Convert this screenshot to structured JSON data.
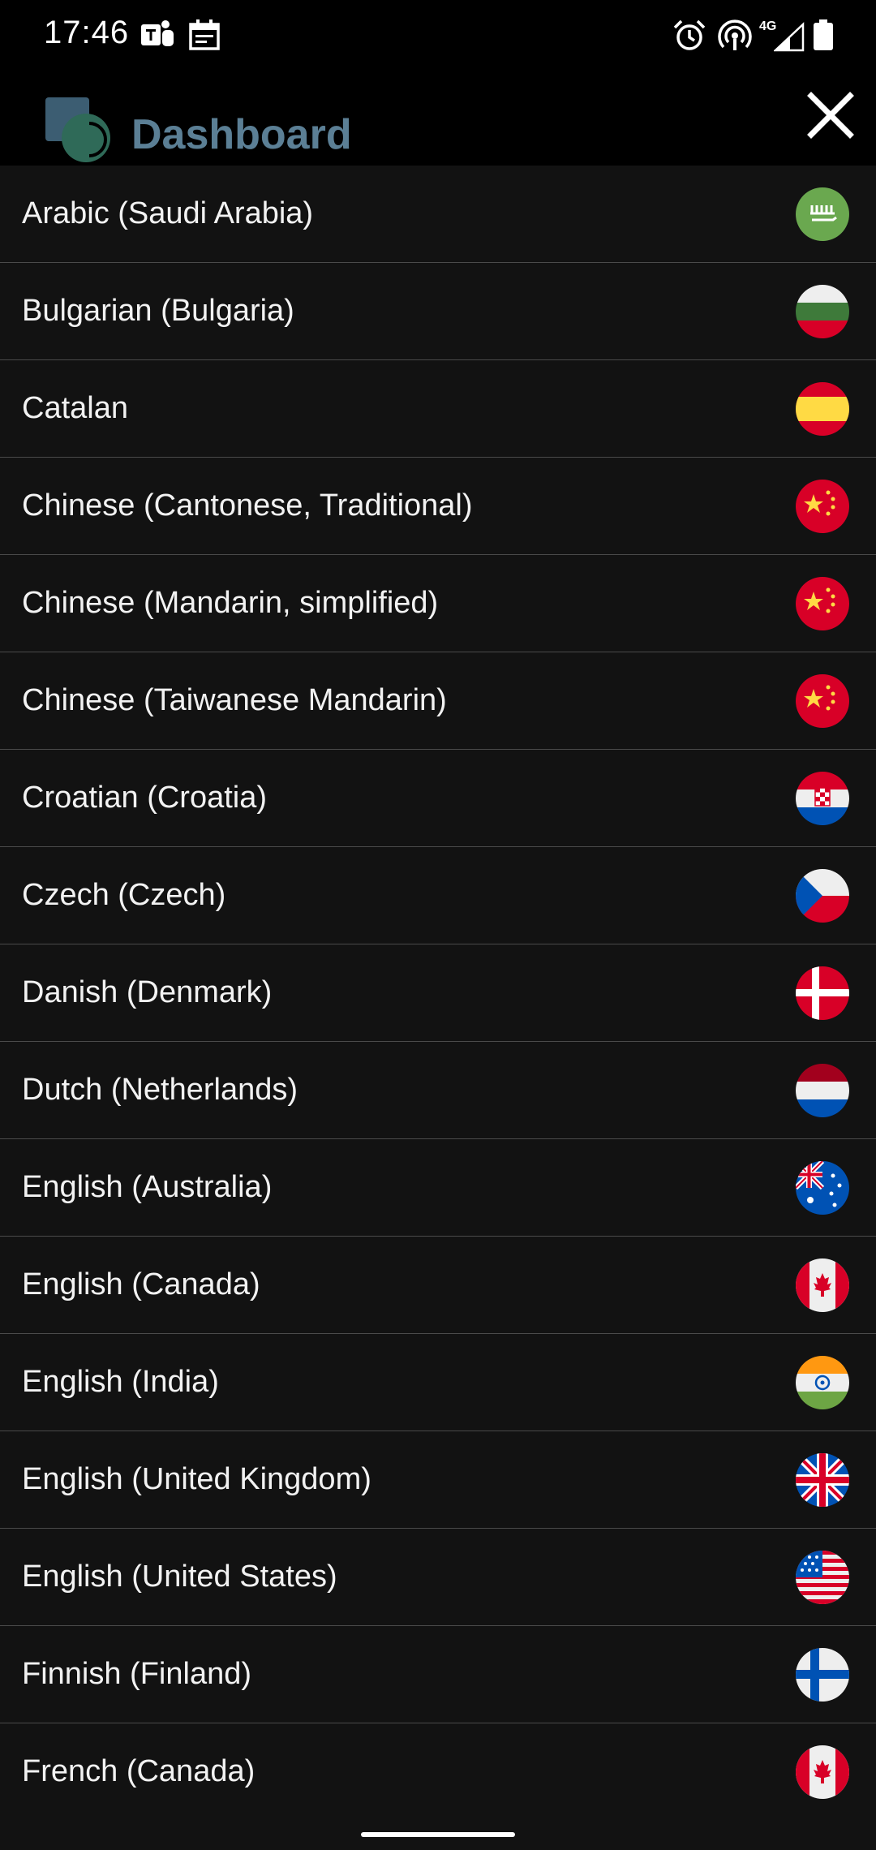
{
  "status_bar": {
    "time": "17:46",
    "network": "4G"
  },
  "header": {
    "title": "Dashboard",
    "accent": "#5b7f95"
  },
  "languages": [
    {
      "label": "Arabic (Saudi Arabia)",
      "flag": "flag-saudi-arabia-icon"
    },
    {
      "label": "Bulgarian (Bulgaria)",
      "flag": "flag-bulgaria-icon"
    },
    {
      "label": "Catalan",
      "flag": "flag-spain-icon"
    },
    {
      "label": "Chinese (Cantonese, Traditional)",
      "flag": "flag-china-icon"
    },
    {
      "label": "Chinese (Mandarin, simplified)",
      "flag": "flag-china-icon"
    },
    {
      "label": "Chinese (Taiwanese Mandarin)",
      "flag": "flag-china-icon"
    },
    {
      "label": "Croatian (Croatia)",
      "flag": "flag-croatia-icon"
    },
    {
      "label": "Czech (Czech)",
      "flag": "flag-czech-icon"
    },
    {
      "label": "Danish (Denmark)",
      "flag": "flag-denmark-icon"
    },
    {
      "label": "Dutch (Netherlands)",
      "flag": "flag-netherlands-icon"
    },
    {
      "label": "English (Australia)",
      "flag": "flag-australia-icon"
    },
    {
      "label": "English (Canada)",
      "flag": "flag-canada-icon"
    },
    {
      "label": "English (India)",
      "flag": "flag-india-icon"
    },
    {
      "label": "English (United Kingdom)",
      "flag": "flag-uk-icon"
    },
    {
      "label": "English (United States)",
      "flag": "flag-usa-icon"
    },
    {
      "label": "Finnish (Finland)",
      "flag": "flag-finland-icon"
    },
    {
      "label": "French (Canada)",
      "flag": "flag-canada-icon"
    }
  ]
}
